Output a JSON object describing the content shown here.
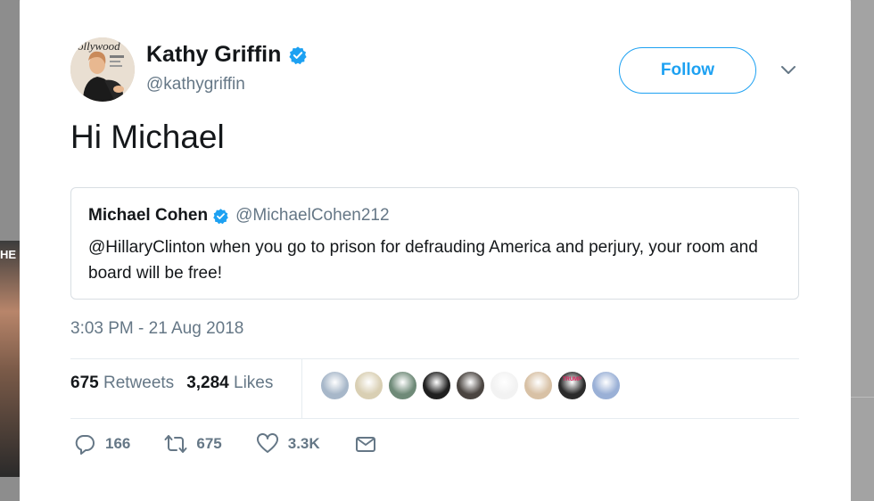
{
  "background": {
    "left_partial_text": "HE"
  },
  "tweet": {
    "author_name": "Kathy Griffin",
    "author_handle": "@kathygriffin",
    "follow_label": "Follow",
    "text": "Hi Michael",
    "avatar_magazine_title": "ollywood"
  },
  "quoted": {
    "author_name": "Michael Cohen",
    "author_handle": "@MichaelCohen212",
    "text": "@HillaryClinton when you go to prison for defrauding America and perjury, your room and board will be free!"
  },
  "meta": {
    "timestamp": "3:03 PM - 21 Aug 2018",
    "retweets_count": "675",
    "retweets_label": "Retweets",
    "likes_count": "3,284",
    "likes_label": "Likes"
  },
  "likers": [
    {
      "name": "liker-1",
      "color": "#a7b7c9"
    },
    {
      "name": "liker-2",
      "color": "#d9cfb3"
    },
    {
      "name": "liker-3",
      "color": "#6f8a78"
    },
    {
      "name": "liker-4",
      "color": "#1f1f1f"
    },
    {
      "name": "liker-5",
      "color": "#4a4440"
    },
    {
      "name": "liker-6",
      "color": "#f2f2f2"
    },
    {
      "name": "liker-7",
      "color": "#d8c1a5"
    },
    {
      "name": "liker-8",
      "color": "#2b2b2b"
    },
    {
      "name": "liker-9",
      "color": "#9ab0d6"
    }
  ],
  "liker_badge_text": "TRUMP",
  "actions": {
    "reply_count": "166",
    "retweet_count": "675",
    "like_count": "3.3K"
  },
  "colors": {
    "accent": "#1da1f2",
    "secondary_text": "#657786",
    "primary_text": "#14171a"
  },
  "icons": [
    "verified-icon",
    "chevron-down-icon",
    "reply-icon",
    "retweet-icon",
    "like-icon",
    "message-icon"
  ]
}
